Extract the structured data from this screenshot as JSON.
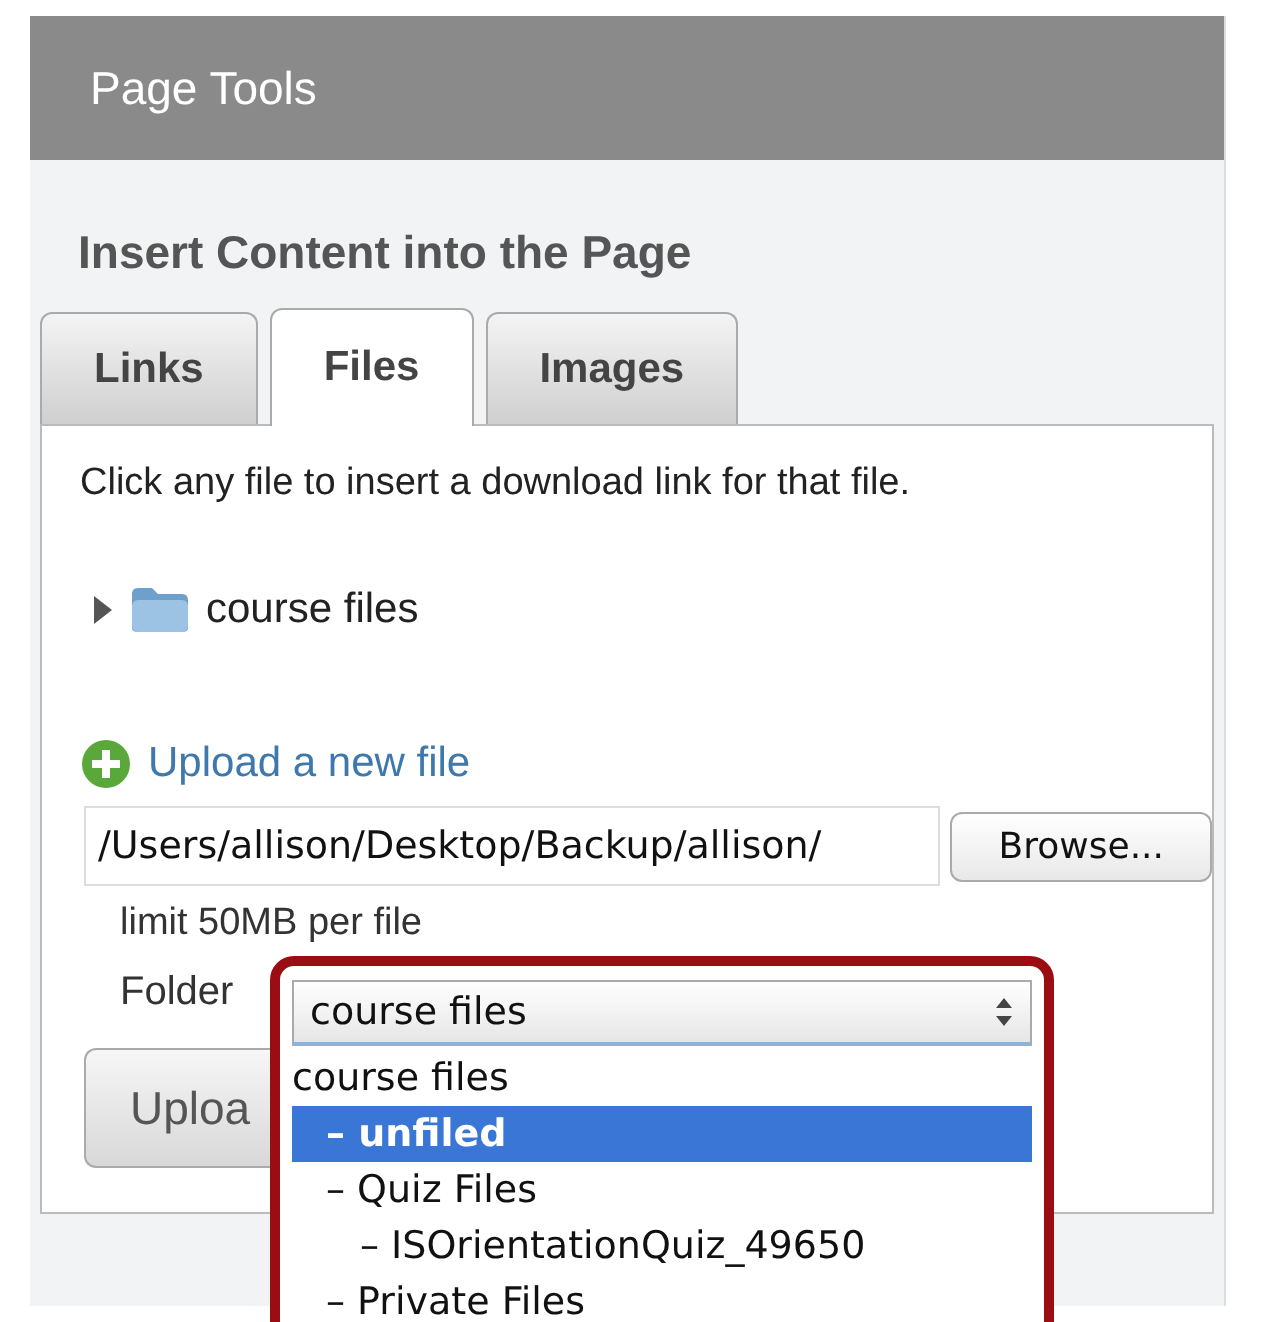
{
  "panel": {
    "title": "Page Tools"
  },
  "heading": "Insert Content into the Page",
  "tabs": [
    {
      "label": "Links",
      "selected": false
    },
    {
      "label": "Files",
      "selected": true
    },
    {
      "label": "Images",
      "selected": false
    }
  ],
  "instructions": "Click any file to insert a download link for that file.",
  "tree": [
    {
      "label": "course files",
      "expanded": false
    }
  ],
  "upload_link": "Upload a new file",
  "file_field": {
    "value": "/Users/allison/Desktop/Backup/allison/"
  },
  "browse_button": "Browse...",
  "limit_note": "limit 50MB per file",
  "folder_label": "Folder",
  "folder_select": {
    "value": "course files"
  },
  "upload_button": "Uploa",
  "folder_options": [
    {
      "label": "course files",
      "selected": false,
      "children": [
        {
          "label": "– unfiled",
          "selected": true
        },
        {
          "label": "– Quiz Files",
          "selected": false,
          "children": [
            {
              "label": "– ISOrientationQuiz_49650",
              "selected": false
            }
          ]
        },
        {
          "label": "– Private Files",
          "selected": false
        }
      ]
    }
  ]
}
